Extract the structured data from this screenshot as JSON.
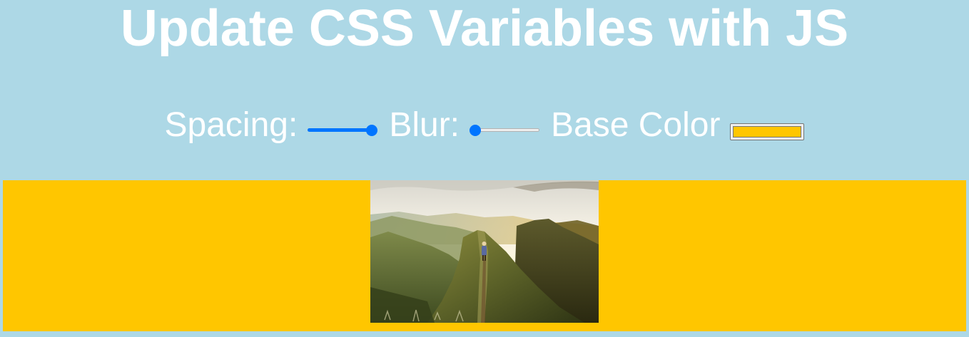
{
  "page": {
    "title": "Update CSS Variables with JS"
  },
  "controls": {
    "spacing": {
      "label": "Spacing:",
      "value": 10,
      "min": 10,
      "max": 200,
      "fraction": 1.0
    },
    "blur": {
      "label": "Blur:",
      "value": 0,
      "min": 0,
      "max": 25,
      "fraction": 0.0
    },
    "base_color": {
      "label": "Base Color",
      "value": "#ffc600"
    }
  },
  "colors": {
    "background": "#add8e6",
    "base": "#ffc600",
    "slider_accent": "#0075ff",
    "text": "#ffffff"
  },
  "image": {
    "description_icon": "mountain-hiker-photo"
  }
}
